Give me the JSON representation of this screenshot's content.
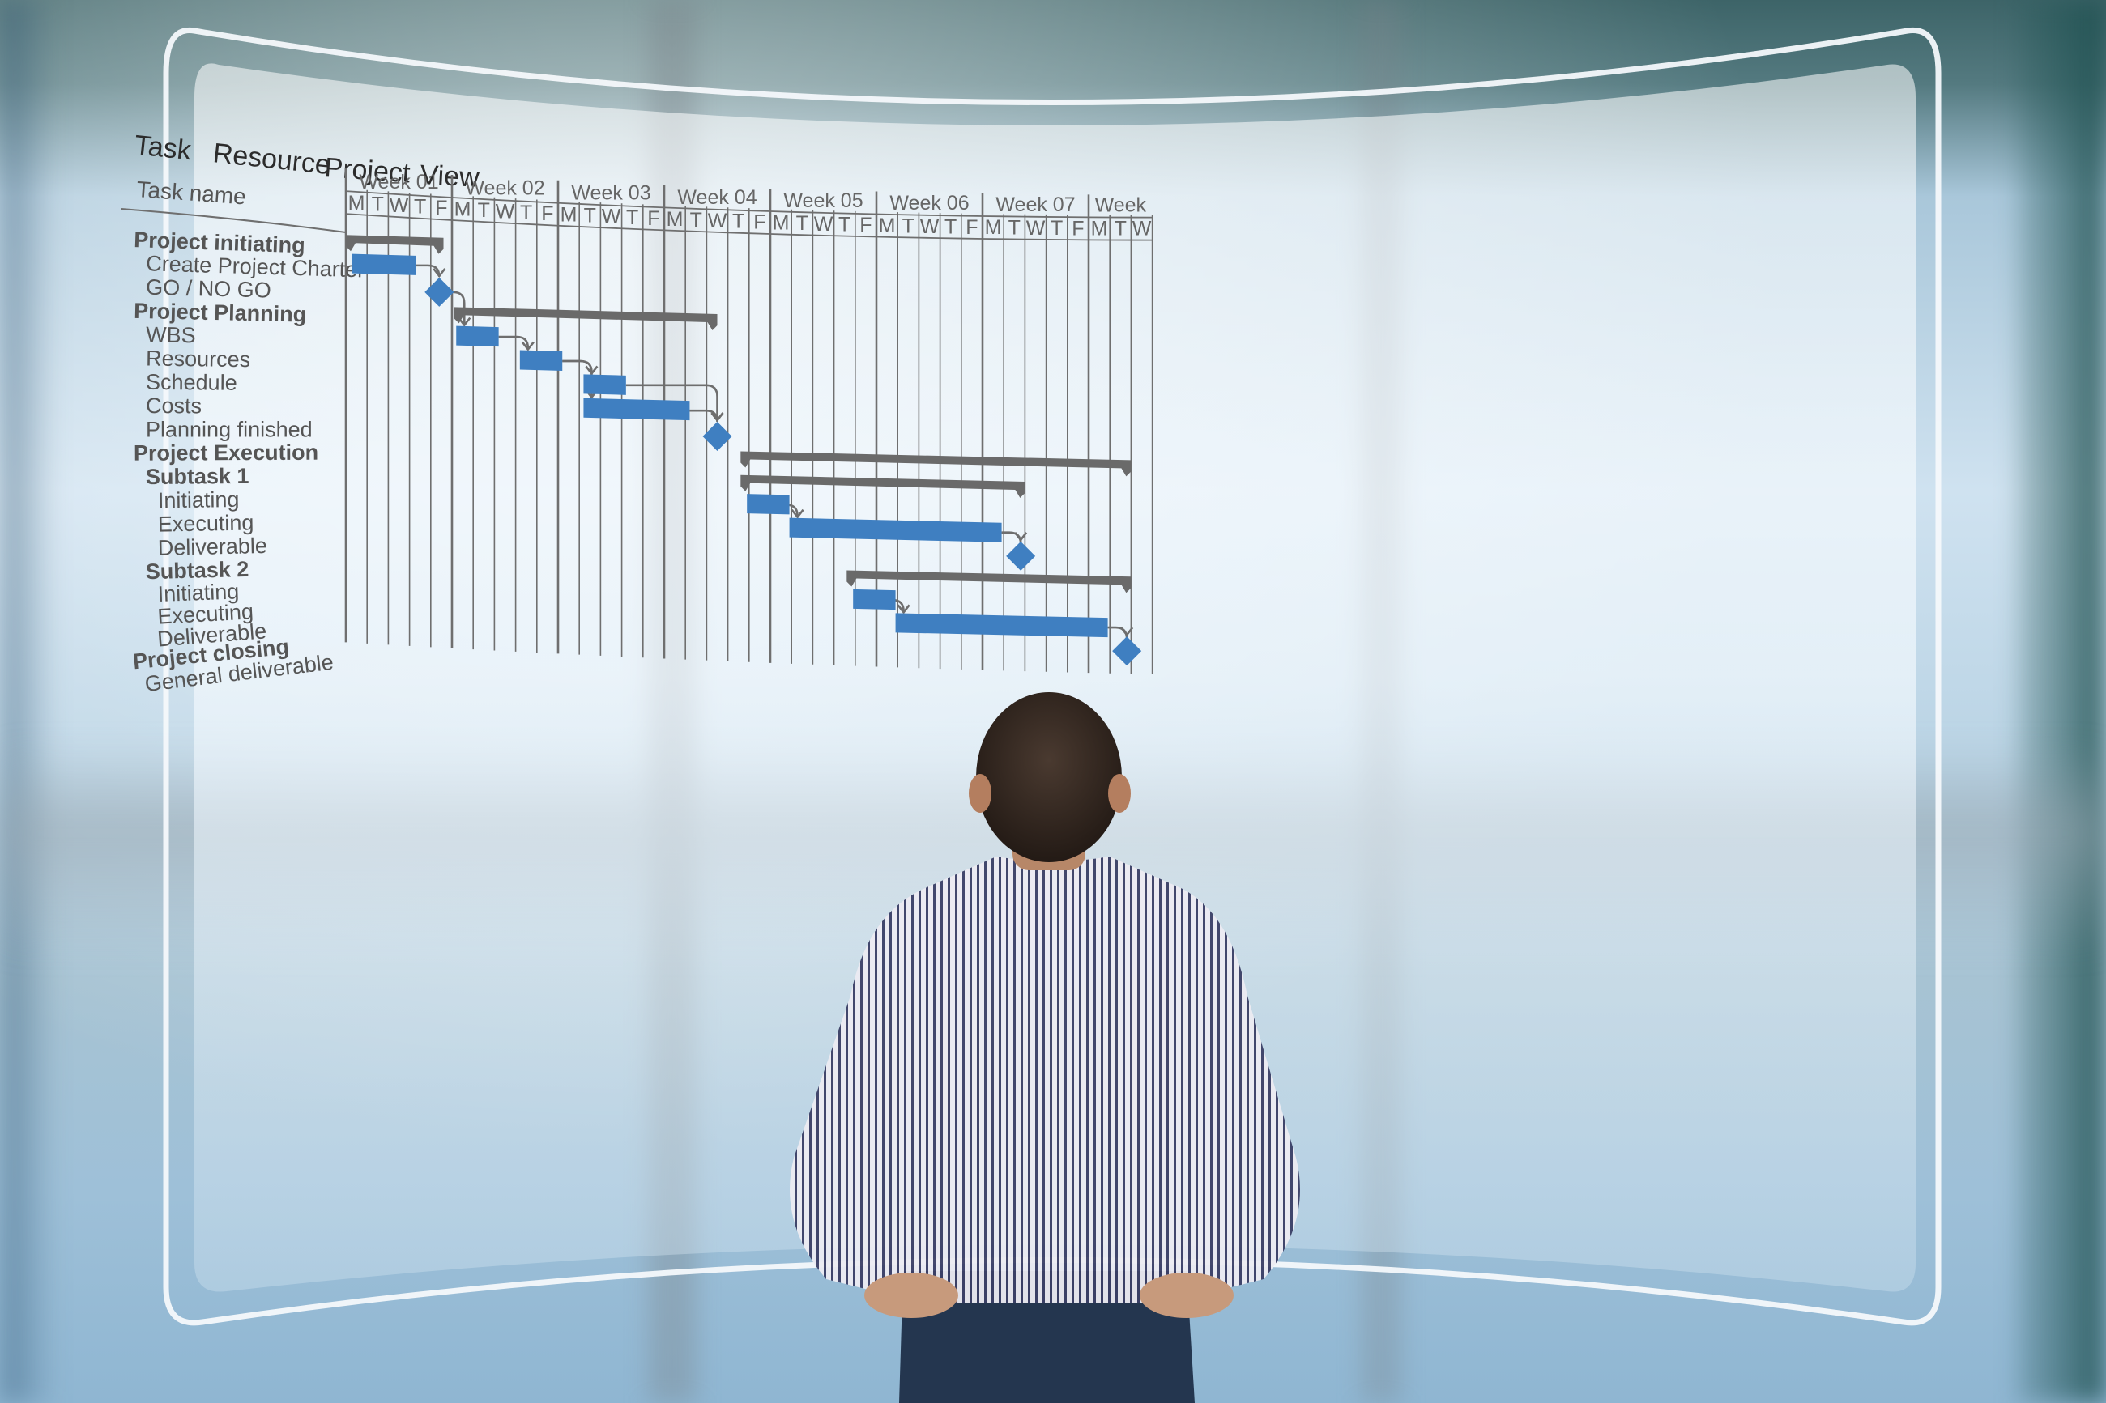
{
  "menu": {
    "items": [
      "Task",
      "Resource",
      "Project",
      "View"
    ]
  },
  "colors": {
    "task_bar": "#3f7fc1",
    "summary_bar": "#6a6a6a",
    "milestone": "#3f7fc1",
    "grid": "#6f6f6f",
    "text": "#555555",
    "panel_edge": "#f4f8fb"
  },
  "chart_data": {
    "type": "gantt",
    "title": "",
    "column_header": "Task name",
    "time_unit": "working day (0 = Week 01 Monday)",
    "weeks": [
      "Week 01",
      "Week 02",
      "Week 03",
      "Week 04",
      "Week 05",
      "Week 06",
      "Week 07",
      "Week"
    ],
    "days_per_week": [
      "M",
      "T",
      "W",
      "T",
      "F"
    ],
    "visible_days": 38,
    "grid": true,
    "tasks": [
      {
        "name": "Project initiating",
        "level": 0,
        "bold": true,
        "kind": "summary",
        "start": 0,
        "end": 4.6
      },
      {
        "name": "Create Project Charter",
        "level": 1,
        "bold": false,
        "kind": "task",
        "start": 0.3,
        "end": 3.3
      },
      {
        "name": "GO / NO GO",
        "level": 1,
        "bold": false,
        "kind": "milestone",
        "at": 4.4
      },
      {
        "name": "Project Planning",
        "level": 0,
        "bold": true,
        "kind": "summary",
        "start": 5.1,
        "end": 17.5
      },
      {
        "name": "WBS",
        "level": 1,
        "bold": false,
        "kind": "task",
        "start": 5.2,
        "end": 7.2
      },
      {
        "name": "Resources",
        "level": 1,
        "bold": false,
        "kind": "task",
        "start": 8.2,
        "end": 10.2
      },
      {
        "name": "Schedule",
        "level": 1,
        "bold": false,
        "kind": "task",
        "start": 11.2,
        "end": 13.2
      },
      {
        "name": "Costs",
        "level": 1,
        "bold": false,
        "kind": "task",
        "start": 11.2,
        "end": 16.2
      },
      {
        "name": "Planning finished",
        "level": 1,
        "bold": false,
        "kind": "milestone",
        "at": 17.5
      },
      {
        "name": "Project Execution",
        "level": 0,
        "bold": true,
        "kind": "summary",
        "start": 18.6,
        "end": 37.0
      },
      {
        "name": "Subtask 1",
        "level": 1,
        "bold": true,
        "kind": "summary",
        "start": 18.6,
        "end": 32.0
      },
      {
        "name": "Initiating",
        "level": 2,
        "bold": false,
        "kind": "task",
        "start": 18.9,
        "end": 20.9
      },
      {
        "name": "Executing",
        "level": 2,
        "bold": false,
        "kind": "task",
        "start": 20.9,
        "end": 30.9
      },
      {
        "name": "Deliverable",
        "level": 2,
        "bold": false,
        "kind": "milestone",
        "at": 31.8
      },
      {
        "name": "Subtask 2",
        "level": 1,
        "bold": true,
        "kind": "summary",
        "start": 23.6,
        "end": 37.0
      },
      {
        "name": "Initiating",
        "level": 2,
        "bold": false,
        "kind": "task",
        "start": 23.9,
        "end": 25.9
      },
      {
        "name": "Executing",
        "level": 2,
        "bold": false,
        "kind": "task",
        "start": 25.9,
        "end": 35.9
      },
      {
        "name": "Deliverable",
        "level": 2,
        "bold": false,
        "kind": "milestone",
        "at": 36.8
      },
      {
        "name": "Project closing",
        "level": 0,
        "bold": true,
        "kind": "label"
      },
      {
        "name": "General deliverable",
        "level": 1,
        "bold": false,
        "kind": "label"
      }
    ],
    "dependencies": [
      [
        "Create Project Charter",
        "GO / NO GO"
      ],
      [
        "GO / NO GO",
        "WBS"
      ],
      [
        "WBS",
        "Resources"
      ],
      [
        "Resources",
        "Schedule"
      ],
      [
        "Resources",
        "Costs"
      ],
      [
        "Schedule",
        "Planning finished"
      ],
      [
        "Costs",
        "Planning finished"
      ],
      [
        "Initiating#1",
        "Executing#1"
      ],
      [
        "Executing#1",
        "Deliverable#1"
      ],
      [
        "Initiating#2",
        "Executing#2"
      ],
      [
        "Executing#2",
        "Deliverable#2"
      ]
    ]
  }
}
